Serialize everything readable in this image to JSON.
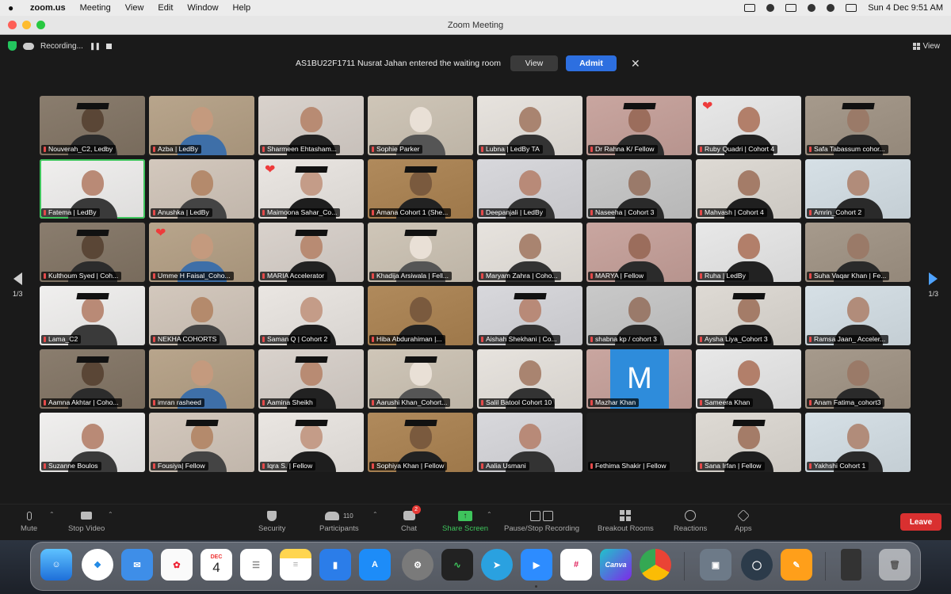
{
  "menubar": {
    "app": "zoom.us",
    "items": [
      "Meeting",
      "View",
      "Edit",
      "Window",
      "Help"
    ],
    "datetime": "Sun 4 Dec  9:51 AM"
  },
  "window": {
    "title": "Zoom Meeting"
  },
  "top": {
    "recording": "Recording...",
    "view": "View"
  },
  "notice": {
    "message": "AS1BU22F1711 Nusrat Jahan entered the waiting room",
    "view_label": "View",
    "admit_label": "Admit"
  },
  "pager": {
    "left": "1/3",
    "right": "1/3"
  },
  "participants": [
    "Nouverah_C2, Ledby",
    "Azba | LedBy",
    "Sharmeen Ehtasham...",
    "Sophie Parker",
    "Lubna | LedBy TA",
    "Dr Rahna K/ Fellow",
    "Ruby Quadri | Cohort 4",
    "Safa Tabassum cohor...",
    "Fatema | LedBy",
    "Anushka | LedBy",
    "Maimoona Sahar_Co...",
    "Amana Cohort 1 (She...",
    "Deepanjali | LedBy",
    "Naseeha | Cohort 3",
    "Mahvash | Cohort 4",
    "Amrin_Cohort 2",
    "Kulthoum Syed | Coh...",
    "Umme H Faisal_Coho...",
    "MARIA Accelerator",
    "Khadija Arsiwala | Fell...",
    "Maryam Zahra | Coho...",
    "MARYA | Fellow",
    "Ruha | LedBy",
    "Suha Vaqar Khan | Fe...",
    "Lama_C2",
    "NEKHA COHORTS",
    "Saman Q | Cohort 2",
    "Hiba Abdurahiman |...",
    "Aishah Shekhani | Co...",
    "shabna kp / cohort 3",
    "Aysha Liya_Cohort 3",
    "Ramsa Jaan_ Acceler...",
    "Aamna Akhtar | Coho...",
    "imran rasheed",
    "Aamina Sheikh",
    "Aarushi Khan_Cohort...",
    "Salil Batool Cohort 10",
    "Mazhar Khan",
    "Sameera Khan",
    "Anam Fatima_cohort3",
    "Suzanne Boulos",
    "Fousiya| Fellow",
    "Iqra S. | Fellow",
    "Sophiya Khan | Fellow",
    "Aalia Usmani",
    "Fethima Shakir | Fellow",
    "Sana Irfan | Fellow",
    "Yakhshi Cohort 1"
  ],
  "avatar_letter": "M",
  "toolbar": {
    "mute": "Mute",
    "stop_video": "Stop Video",
    "security": "Security",
    "participants": "Participants",
    "participants_count": "110",
    "chat": "Chat",
    "chat_badge": "2",
    "share": "Share Screen",
    "record": "Pause/Stop Recording",
    "breakout": "Breakout Rooms",
    "reactions": "Reactions",
    "apps": "Apps",
    "leave": "Leave"
  },
  "dock": {
    "calendar_month": "DEC",
    "calendar_day": "4",
    "canva_label": "Canva"
  },
  "colors": {
    "accent": "#2d6fe0",
    "leave": "#d93030",
    "share": "#3ec45c",
    "avatar": "#2e8cdb"
  }
}
